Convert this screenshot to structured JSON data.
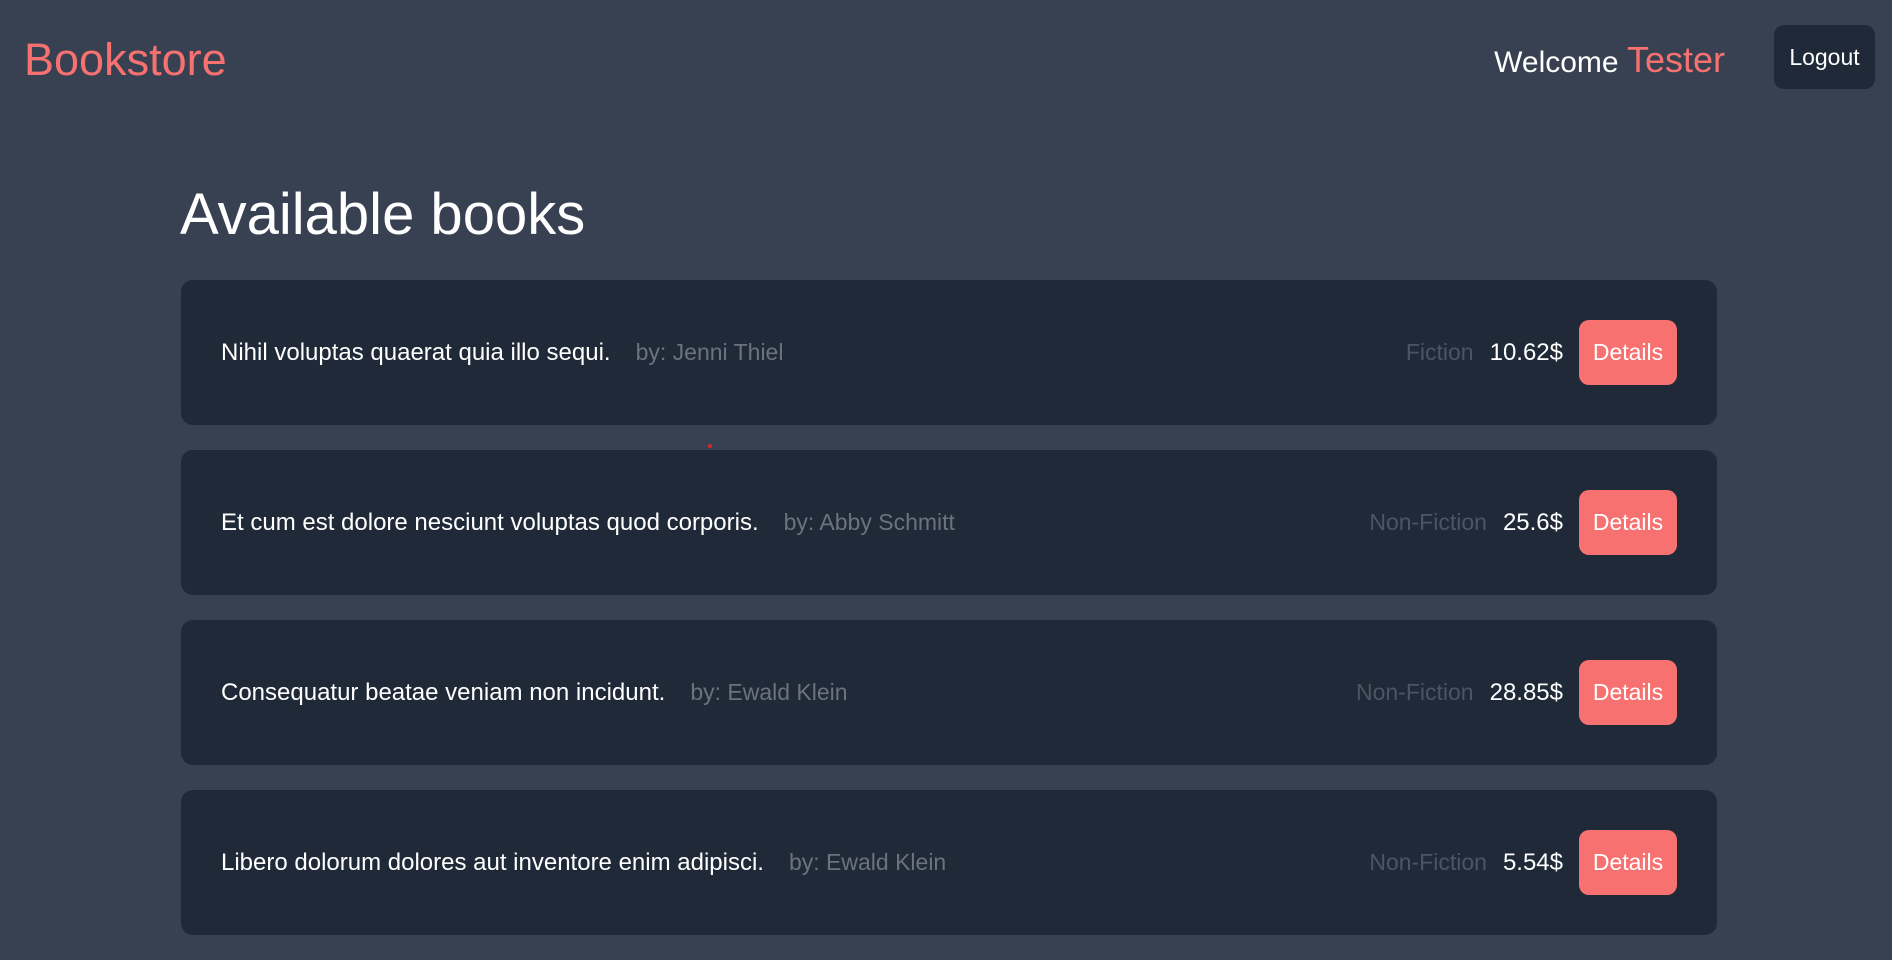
{
  "header": {
    "brand": "Bookstore",
    "welcome_text": "Welcome",
    "username": "Tester",
    "logout_label": "Logout"
  },
  "main": {
    "title": "Available books",
    "books": [
      {
        "title": "Nihil voluptas quaerat quia illo sequi.",
        "author": "by: Jenni Thiel",
        "genre": "Fiction",
        "price": "10.62$",
        "details_label": "Details"
      },
      {
        "title": "Et cum est dolore nesciunt voluptas quod corporis.",
        "author": "by: Abby Schmitt",
        "genre": "Non-Fiction",
        "price": "25.6$",
        "details_label": "Details"
      },
      {
        "title": "Consequatur beatae veniam non incidunt.",
        "author": "by: Ewald Klein",
        "genre": "Non-Fiction",
        "price": "28.85$",
        "details_label": "Details"
      },
      {
        "title": "Libero dolorum dolores aut inventore enim adipisci.",
        "author": "by: Ewald Klein",
        "genre": "Non-Fiction",
        "price": "5.54$",
        "details_label": "Details"
      }
    ]
  },
  "colors": {
    "background": "#374151",
    "card": "#1f2937",
    "accent": "#f87171",
    "muted_text": "#6b7280",
    "genre_text": "#4b5563"
  }
}
